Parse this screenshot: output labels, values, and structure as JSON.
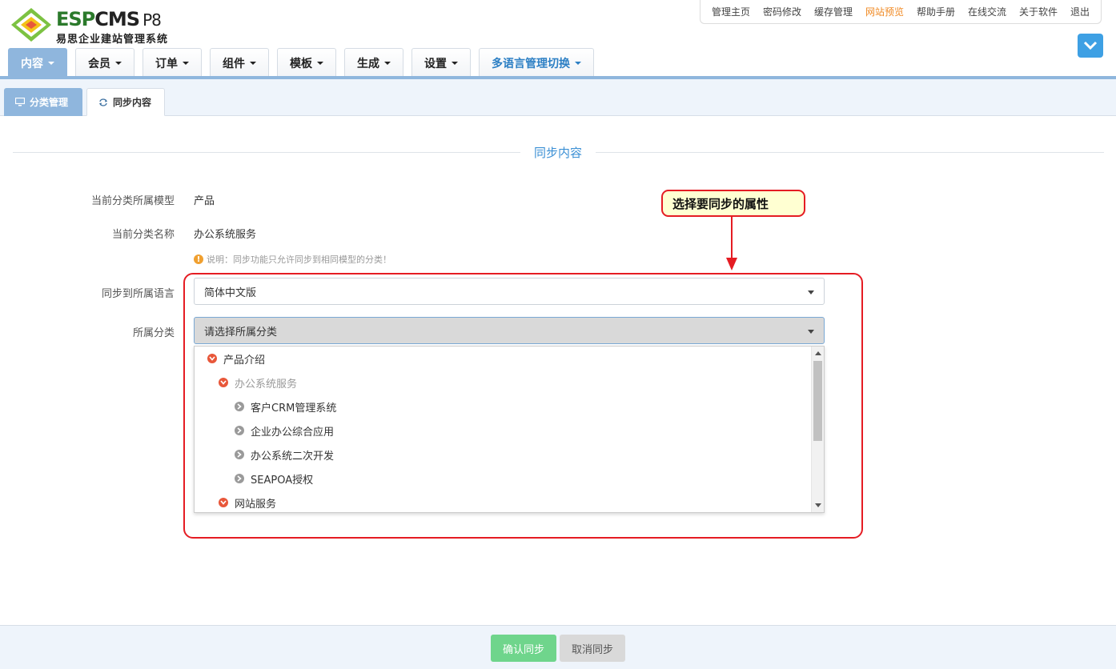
{
  "brand": {
    "name_prefix": "ESP",
    "name_suffix": "CMS",
    "version": "P8",
    "subtitle": "易思企业建站管理系统"
  },
  "toplinks": [
    "管理主页",
    "密码修改",
    "缓存管理",
    "网站预览",
    "帮助手册",
    "在线交流",
    "关于软件",
    "退出"
  ],
  "toplinks_highlight_index": 3,
  "mainnav": [
    "内容",
    "会员",
    "订单",
    "组件",
    "模板",
    "生成",
    "设置",
    "多语言管理切换"
  ],
  "mainnav_active_index": 0,
  "subtabs": [
    "分类管理",
    "同步内容"
  ],
  "section_title": "同步内容",
  "form": {
    "model_label": "当前分类所属模型",
    "model_value": "产品",
    "name_label": "当前分类名称",
    "name_value": "办公系统服务",
    "note": "说明：同步功能只允许同步到相同模型的分类！",
    "lang_label": "同步到所属语言",
    "lang_value": "简体中文版",
    "cat_label": "所属分类",
    "cat_placeholder": "请选择所属分类"
  },
  "dropdown_items": [
    {
      "label": "产品介绍",
      "level": 0,
      "style": "expanded"
    },
    {
      "label": "办公系统服务",
      "level": 1,
      "style": "expanded-disabled"
    },
    {
      "label": "客户CRM管理系统",
      "level": 2,
      "style": "leaf"
    },
    {
      "label": "企业办公综合应用",
      "level": 2,
      "style": "leaf"
    },
    {
      "label": "办公系统二次开发",
      "level": 2,
      "style": "leaf"
    },
    {
      "label": "SEAPOA授权",
      "level": 2,
      "style": "leaf"
    },
    {
      "label": "网站服务",
      "level": 1,
      "style": "expanded"
    }
  ],
  "annotation": "选择要同步的属性",
  "buttons": {
    "confirm": "确认同步",
    "cancel": "取消同步"
  },
  "colors": {
    "accent": "#3a8fd4",
    "nav_active": "#8fb6dd",
    "highlight_orange": "#f08a24",
    "annotation_red": "#e51c23",
    "confirm_green": "#6fd58c"
  }
}
